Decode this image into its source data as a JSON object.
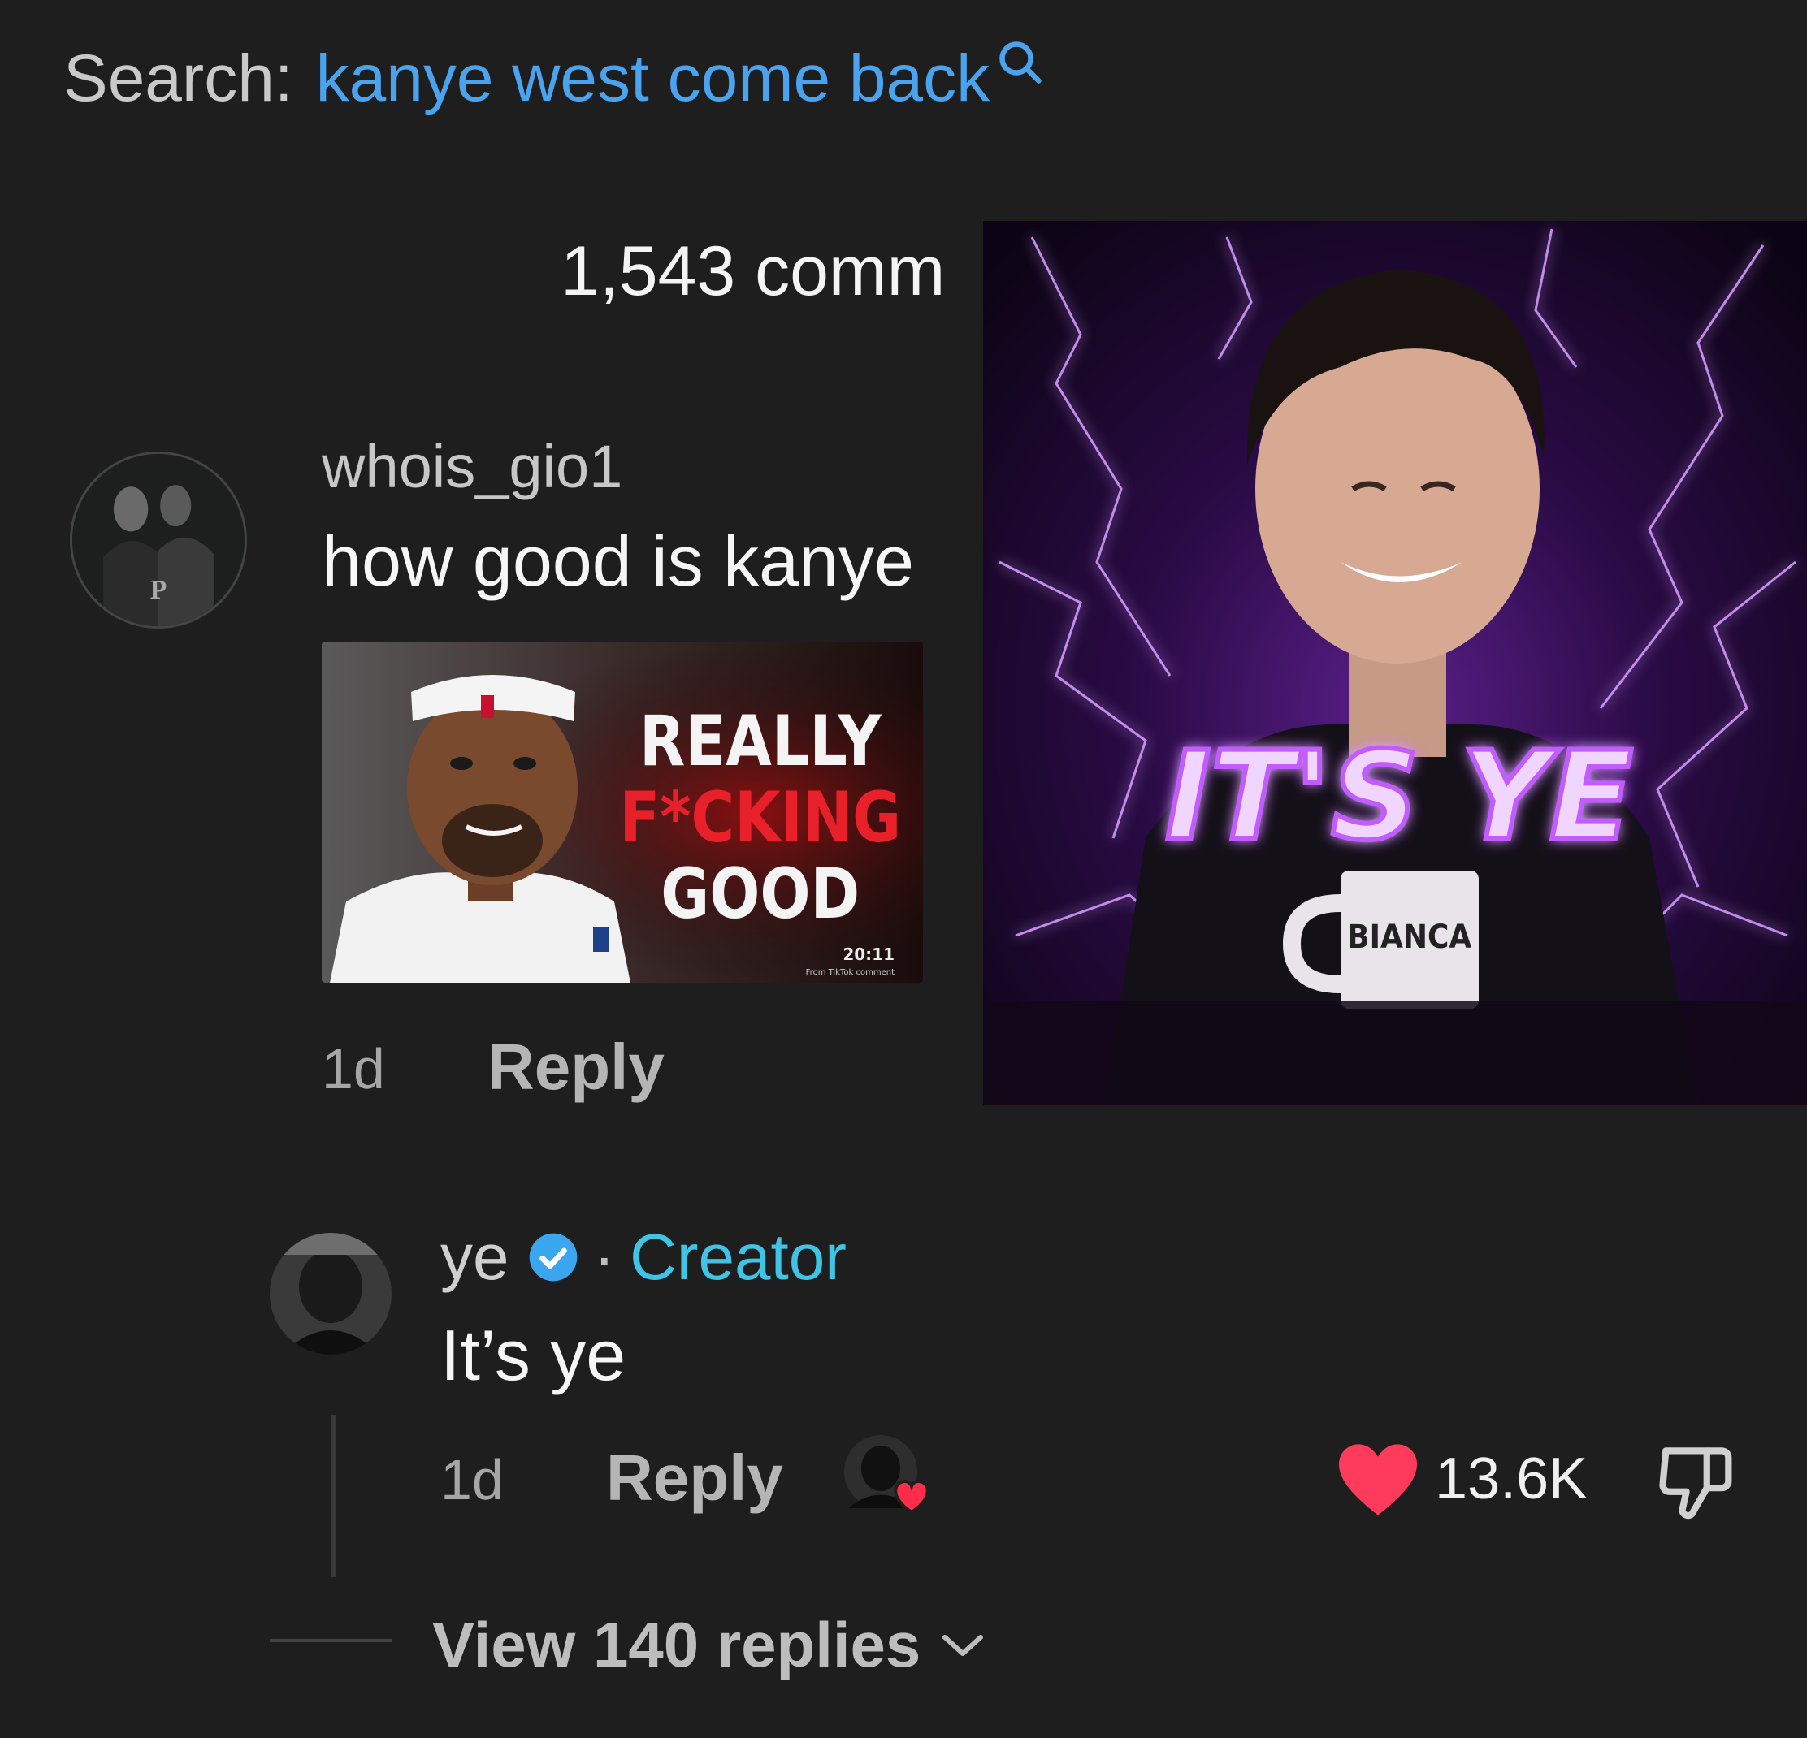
{
  "search": {
    "prefix": "Search:",
    "query": "kanye west come back",
    "icon": "search-icon"
  },
  "comments_header": {
    "count_text": "1,543 comm"
  },
  "comment_1": {
    "username": "whois_gio1",
    "text": "how good is kanye",
    "avatar_letter": "P",
    "image": {
      "line1": "REALLY",
      "line2": "F*CKING",
      "line3": "GOOD",
      "watermark_time": "20:11",
      "watermark_source": "From TikTok comment"
    },
    "time": "1d",
    "reply_label": "Reply"
  },
  "overlay_image": {
    "text": "IT'S YE",
    "mug_text": "BIANCA"
  },
  "comment_2": {
    "username": "ye",
    "verified_icon": "verified-badge-icon",
    "separator": "·",
    "creator_label": "Creator",
    "text": "It’s ye",
    "time": "1d",
    "reply_label": "Reply",
    "like_count": "13.6K",
    "colors": {
      "like": "#ff3b5c",
      "creator": "#3fc4e6",
      "link": "#4aa3ef"
    }
  },
  "view_replies": {
    "label": "View 140 replies"
  }
}
